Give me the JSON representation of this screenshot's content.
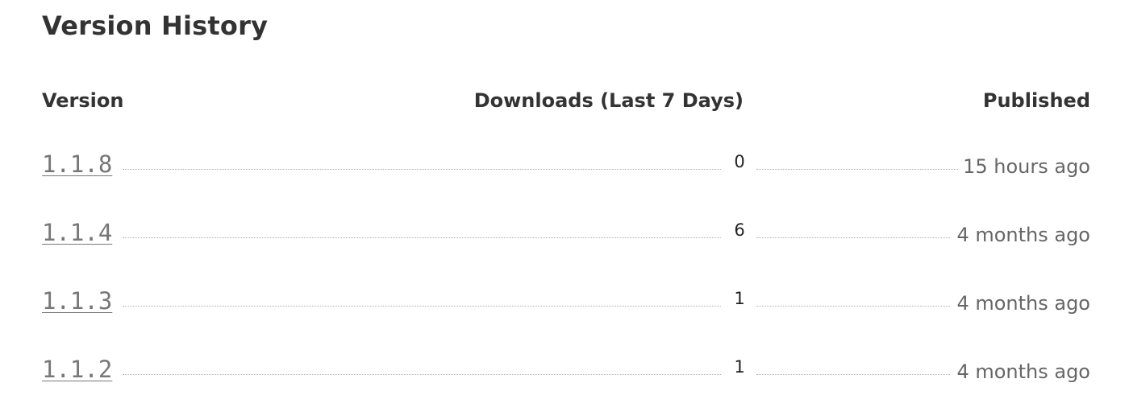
{
  "section": {
    "title": "Version History"
  },
  "table": {
    "headers": {
      "version": "Version",
      "downloads": "Downloads (Last 7 Days)",
      "published": "Published"
    },
    "rows": [
      {
        "version": "1.1.8",
        "downloads": "0",
        "published": "15 hours ago"
      },
      {
        "version": "1.1.4",
        "downloads": "6",
        "published": "4 months ago"
      },
      {
        "version": "1.1.3",
        "downloads": "1",
        "published": "4 months ago"
      },
      {
        "version": "1.1.2",
        "downloads": "1",
        "published": "4 months ago"
      }
    ]
  },
  "colors": {
    "text": "#333333",
    "link": "#777777",
    "muted": "#666666",
    "leader": "#b0b0b0"
  }
}
